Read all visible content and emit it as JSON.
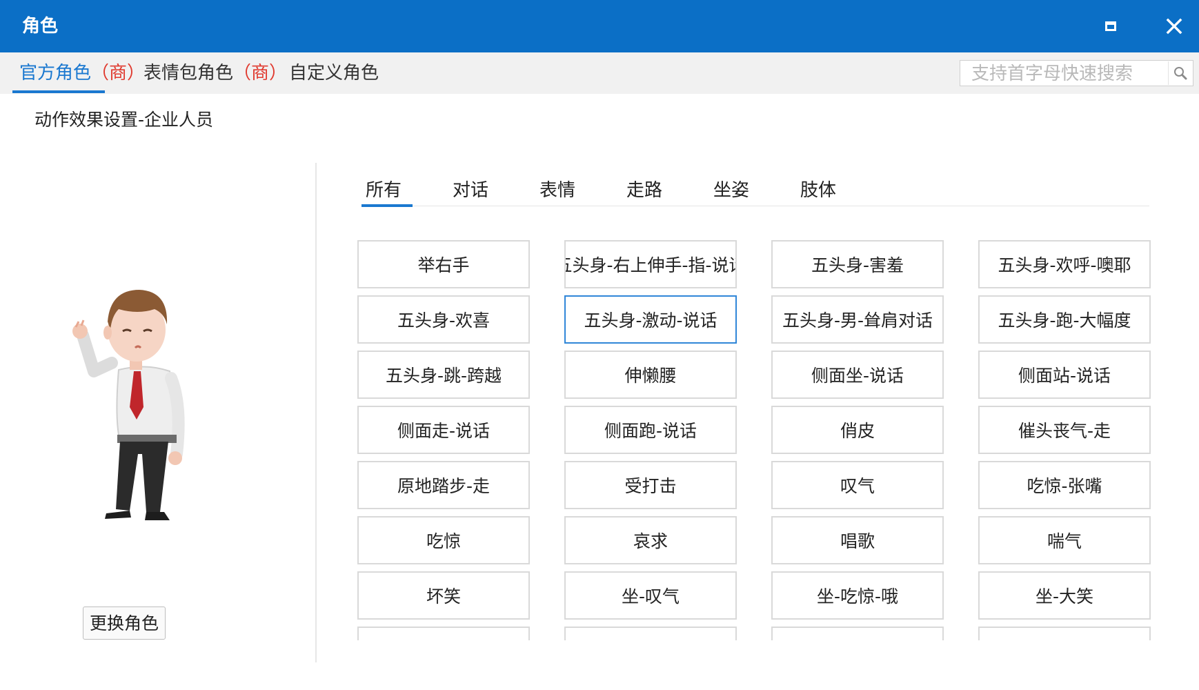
{
  "window": {
    "title": "角色"
  },
  "top_tabs": [
    {
      "label": "官方角色",
      "mark": "（商）",
      "active": true
    },
    {
      "label": "表情包角色",
      "mark": "（商）",
      "active": false
    },
    {
      "label": "自定义角色",
      "mark": "",
      "active": false
    }
  ],
  "search": {
    "placeholder": "支持首字母快速搜索",
    "value": ""
  },
  "subtitle": "动作效果设置-企业人员",
  "change_role_label": "更换角色",
  "category_tabs": [
    {
      "label": "所有",
      "active": true
    },
    {
      "label": "对话",
      "active": false
    },
    {
      "label": "表情",
      "active": false
    },
    {
      "label": "走路",
      "active": false
    },
    {
      "label": "坐姿",
      "active": false
    },
    {
      "label": "肢体",
      "active": false
    }
  ],
  "actions": [
    "举右手",
    "五头身-右上伸手-指-说话",
    "五头身-害羞",
    "五头身-欢呼-噢耶",
    "五头身-欢喜",
    "五头身-激动-说话",
    "五头身-男-耸肩对话",
    "五头身-跑-大幅度",
    "五头身-跳-跨越",
    "伸懒腰",
    "侧面坐-说话",
    "侧面站-说话",
    "侧面走-说话",
    "侧面跑-说话",
    "俏皮",
    "催头丧气-走",
    "原地踏步-走",
    "受打击",
    "叹气",
    "吃惊-张嘴",
    "吃惊",
    "哀求",
    "唱歌",
    "喘气",
    "坏笑",
    "坐-叹气",
    "坐-吃惊-哦",
    "坐-大笑",
    "",
    "",
    "",
    ""
  ],
  "selected_action": "五头身-激动-说话",
  "colors": {
    "titlebar": "#0b6fc6",
    "accent": "#1a78d0",
    "mark": "#e03a2f",
    "selected_border": "#2f86d8"
  },
  "icons": {
    "maximize": "maximize-icon",
    "close": "close-icon",
    "search": "search-icon"
  }
}
